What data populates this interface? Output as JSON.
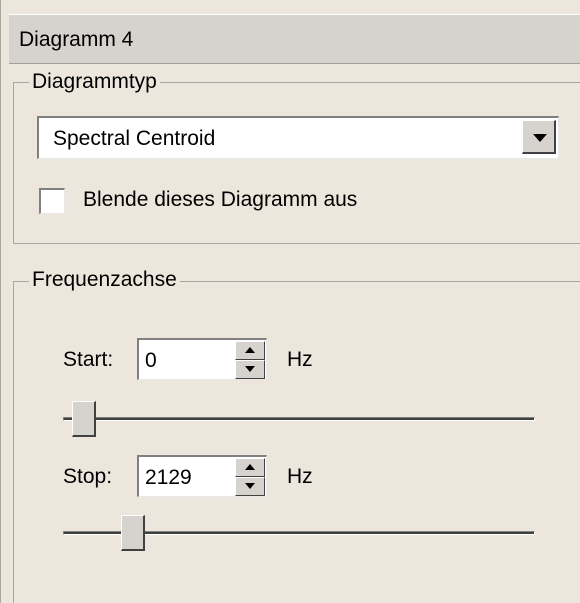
{
  "panel": {
    "title": "Diagramm 4"
  },
  "diagram_type": {
    "legend": "Diagrammtyp",
    "selected": "Spectral Centroid",
    "hide_checkbox": {
      "label": "Blende dieses Diagramm aus",
      "checked": false
    }
  },
  "frequency_axis": {
    "legend": "Frequenzachse",
    "start": {
      "label": "Start:",
      "value": "0",
      "unit": "Hz",
      "slider_fraction": 0.02
    },
    "stop": {
      "label": "Stop:",
      "value": "2129",
      "unit": "Hz",
      "slider_fraction": 0.13
    }
  },
  "colors": {
    "panel_bg": "#ede6dd",
    "control_face": "#d6d3ce"
  },
  "icons": {
    "dropdown": "chevron-down-icon",
    "spin_up": "arrow-up-icon",
    "spin_down": "arrow-down-icon"
  }
}
